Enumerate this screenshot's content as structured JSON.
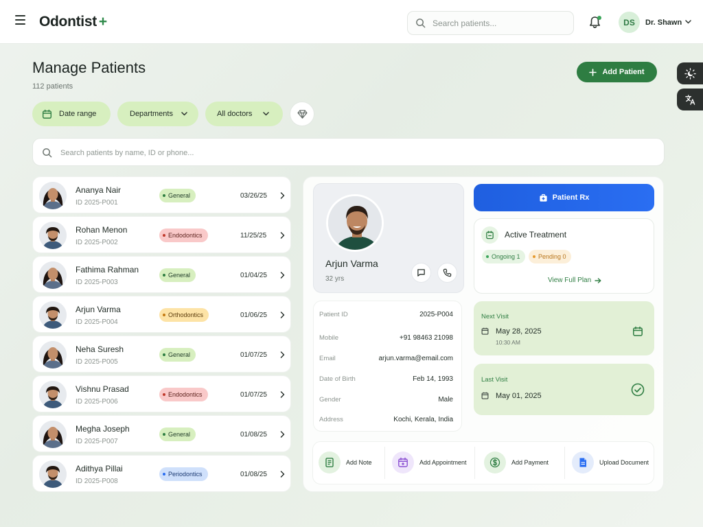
{
  "app": {
    "brand": "Odontist",
    "brand_plus": "+"
  },
  "header": {
    "search_placeholder": "Search patients...",
    "user_initials": "DS",
    "user_name": "Dr. Shawn"
  },
  "page": {
    "title": "Manage Patients",
    "count": "112 patients",
    "add_button": "Add Patient"
  },
  "filters": {
    "date_range": "Date range",
    "departments": "Departments",
    "doctors": "All doctors"
  },
  "search": {
    "placeholder": "Search patients by name, ID or phone..."
  },
  "colors": {
    "accent": "#2e7d42",
    "blue": "#2a6ef2",
    "general": "#d7efbf",
    "endodontics": "#f9c9c9",
    "orthodontics": "#fde3a6",
    "periodontics": "#cfe0fb"
  },
  "patients": [
    {
      "name": "Ananya Nair",
      "id": "ID 2025-P001",
      "dept": "General",
      "date": "03/26/25",
      "tone": "general",
      "gender": "f"
    },
    {
      "name": "Rohan Menon",
      "id": "ID 2025-P002",
      "dept": "Endodontics",
      "date": "11/25/25",
      "tone": "endo",
      "gender": "m"
    },
    {
      "name": "Fathima Rahman",
      "id": "ID 2025-P003",
      "dept": "General",
      "date": "01/04/25",
      "tone": "general",
      "gender": "f"
    },
    {
      "name": "Arjun Varma",
      "id": "ID 2025-P004",
      "dept": "Orthodontics",
      "date": "01/06/25",
      "tone": "ortho",
      "gender": "m"
    },
    {
      "name": "Neha Suresh",
      "id": "ID 2025-P005",
      "dept": "General",
      "date": "01/07/25",
      "tone": "general",
      "gender": "f"
    },
    {
      "name": "Vishnu Prasad",
      "id": "ID 2025-P006",
      "dept": "Endodontics",
      "date": "01/07/25",
      "tone": "endo",
      "gender": "m"
    },
    {
      "name": "Megha Joseph",
      "id": "ID 2025-P007",
      "dept": "General",
      "date": "01/08/25",
      "tone": "general",
      "gender": "f"
    },
    {
      "name": "Adithya Pillai",
      "id": "ID 2025-P008",
      "dept": "Periodontics",
      "date": "01/08/25",
      "tone": "perio",
      "gender": "m"
    }
  ],
  "profile": {
    "name": "Arjun Varma",
    "age": "32 yrs"
  },
  "info": [
    {
      "label": "Patient ID",
      "value": "2025-P004"
    },
    {
      "label": "Mobile",
      "value": "+91 98463 21098"
    },
    {
      "label": "Email",
      "value": "arjun.varma@email.com"
    },
    {
      "label": "Date of Birth",
      "value": "Feb 14, 1993"
    },
    {
      "label": "Gender",
      "value": "Male"
    },
    {
      "label": "Address",
      "value": "Kochi, Kerala, India"
    }
  ],
  "rx": {
    "label": "Patient Rx"
  },
  "treatment": {
    "title": "Active Treatment",
    "ongoing": "Ongoing 1",
    "pending": "Pending 0",
    "view_plan": "View Full Plan"
  },
  "next_visit": {
    "label": "Next Visit",
    "date": "May 28, 2025",
    "time": "10:30 AM"
  },
  "last_visit": {
    "label": "Last Visit",
    "date": "May 01, 2025"
  },
  "actions": [
    {
      "label": "Add Note"
    },
    {
      "label": "Add Appointment"
    },
    {
      "label": "Add Payment"
    },
    {
      "label": "Upload Document"
    }
  ]
}
